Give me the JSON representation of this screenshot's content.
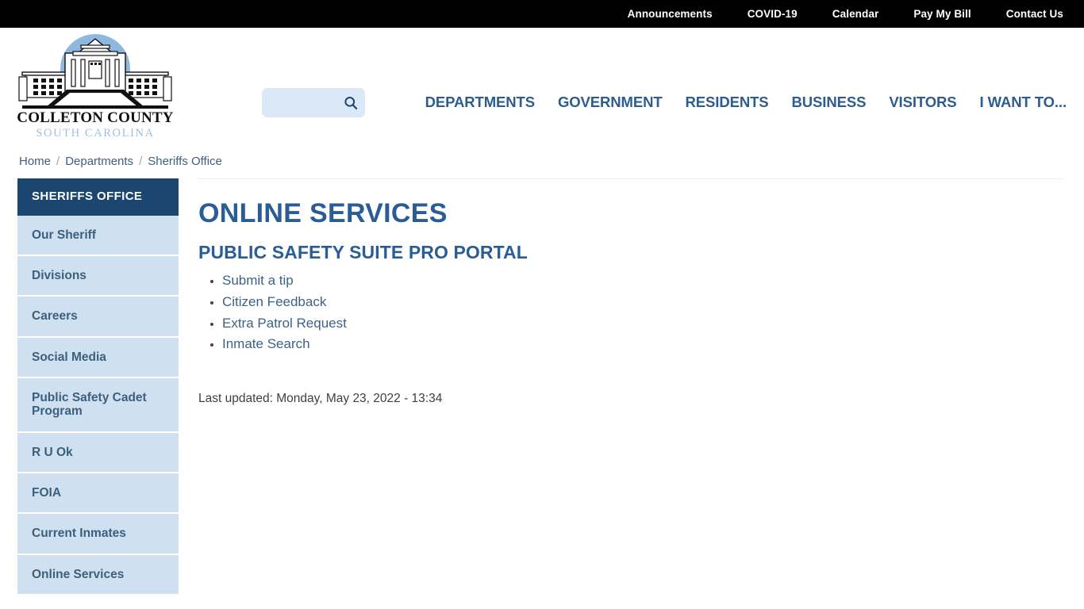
{
  "utility_nav": {
    "items": [
      {
        "label": "Announcements",
        "name": "announcements"
      },
      {
        "label": "COVID-19",
        "name": "covid-19"
      },
      {
        "label": "Calendar",
        "name": "calendar"
      },
      {
        "label": "Pay My Bill",
        "name": "pay-my-bill"
      },
      {
        "label": "Contact Us",
        "name": "contact-us"
      }
    ]
  },
  "logo": {
    "name_line": "COLLETON COUNTY",
    "state_line": "SOUTH CAROLINA",
    "icon": "courthouse-icon"
  },
  "search": {
    "value": "",
    "placeholder": "",
    "icon": "search-icon"
  },
  "main_nav": {
    "items": [
      {
        "label": "DEPARTMENTS",
        "name": "departments"
      },
      {
        "label": "GOVERNMENT",
        "name": "government"
      },
      {
        "label": "RESIDENTS",
        "name": "residents"
      },
      {
        "label": "BUSINESS",
        "name": "business"
      },
      {
        "label": "VISITORS",
        "name": "visitors"
      },
      {
        "label": "I WANT TO...",
        "name": "i-want-to"
      }
    ]
  },
  "breadcrumb": {
    "items": [
      "Home",
      "Departments",
      "Sheriffs Office"
    ],
    "separator": "/"
  },
  "sidebar": {
    "header": "SHERIFFS OFFICE",
    "items": [
      {
        "label": "Our Sheriff",
        "name": "our-sheriff"
      },
      {
        "label": "Divisions",
        "name": "divisions"
      },
      {
        "label": "Careers",
        "name": "careers"
      },
      {
        "label": "Social Media",
        "name": "social-media"
      },
      {
        "label": "Public Safety Cadet Program",
        "name": "public-safety-cadet-program"
      },
      {
        "label": "R U Ok",
        "name": "r-u-ok"
      },
      {
        "label": "FOIA",
        "name": "foia"
      },
      {
        "label": "Current Inmates",
        "name": "current-inmates"
      },
      {
        "label": "Online Services",
        "name": "online-services"
      }
    ]
  },
  "main": {
    "page_title": "ONLINE SERVICES",
    "section_title": "PUBLIC SAFETY SUITE PRO PORTAL",
    "links": [
      {
        "label": "Submit a tip",
        "name": "submit-a-tip"
      },
      {
        "label": "Citizen Feedback",
        "name": "citizen-feedback"
      },
      {
        "label": "Extra Patrol Request",
        "name": "extra-patrol-request"
      },
      {
        "label": "Inmate Search",
        "name": "inmate-search"
      }
    ],
    "last_updated": "Last updated: Monday, May 23, 2022 - 13:34"
  },
  "colors": {
    "utility_bar_bg": "#000000",
    "brand_blue": "#2a5d96",
    "sidebar_header_bg": "#1b4670",
    "sidebar_item_bg": "#cfe0f0",
    "search_bg": "#dbe8f7",
    "logo_state_blue": "#9dc0e4"
  }
}
